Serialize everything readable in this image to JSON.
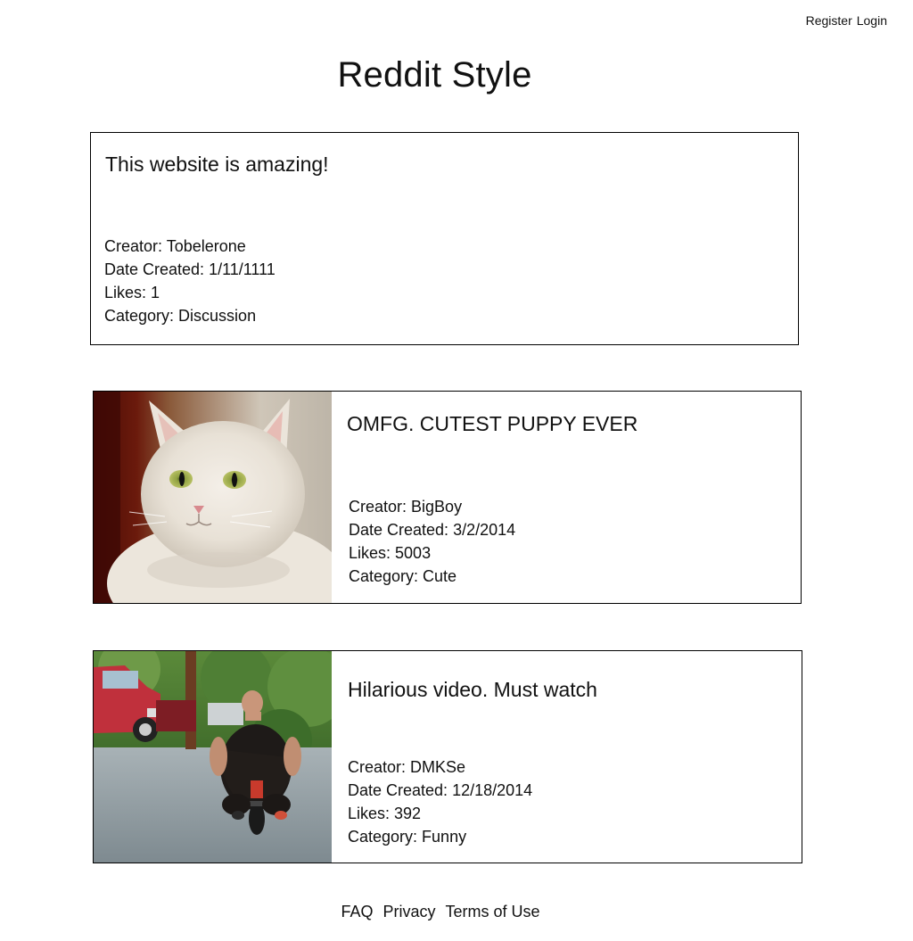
{
  "header": {
    "register_label": "Register",
    "login_label": "Login",
    "site_title": "Reddit Style"
  },
  "posts": [
    {
      "title": "This website is amazing!",
      "creator_label": "Creator: ",
      "creator": "Tobelerone",
      "date_label": "Date Created: ",
      "date": "1/11/1111",
      "likes_label": "Likes: ",
      "likes": "1",
      "category_label": "Category: ",
      "category": "Discussion",
      "has_image": false
    },
    {
      "title": "OMFG. CUTEST PUPPY EVER",
      "creator_label": "Creator: ",
      "creator": "BigBoy",
      "date_label": "Date Created: ",
      "date": "3/2/2014",
      "likes_label": "Likes: ",
      "likes": "5003",
      "category_label": "Category: ",
      "category": "Cute",
      "has_image": true,
      "image_subject": "white-cat-photo"
    },
    {
      "title": "Hilarious video. Must watch",
      "creator_label": "Creator: ",
      "creator": "DMKSe",
      "date_label": "Date Created: ",
      "date": "12/18/2014",
      "likes_label": "Likes: ",
      "likes": "392",
      "category_label": "Category: ",
      "category": "Funny",
      "has_image": true,
      "image_subject": "man-on-minibike-photo"
    }
  ],
  "footer": {
    "faq_label": "FAQ",
    "privacy_label": "Privacy",
    "terms_label": "Terms of Use"
  }
}
